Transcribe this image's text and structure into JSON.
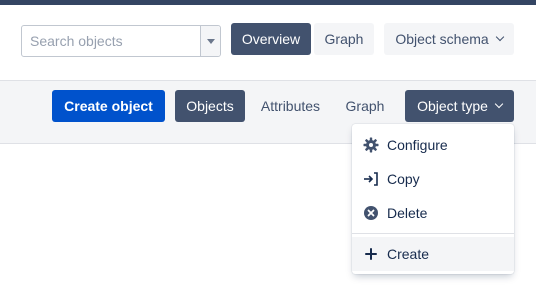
{
  "search": {
    "placeholder": "Search objects"
  },
  "header_nav": {
    "overview": "Overview",
    "graph": "Graph",
    "object_schema": "Object schema"
  },
  "toolbar": {
    "create_object": "Create object",
    "objects": "Objects",
    "attributes": "Attributes",
    "graph": "Graph",
    "object_type": "Object type"
  },
  "dropdown": {
    "items": [
      {
        "label": "Configure",
        "icon": "gear-icon"
      },
      {
        "label": "Copy",
        "icon": "copy-icon"
      },
      {
        "label": "Delete",
        "icon": "delete-icon"
      },
      {
        "label": "Create",
        "icon": "plus-icon"
      }
    ]
  },
  "colors": {
    "dark_button": "#42526e",
    "primary": "#0052cc",
    "top_bar": "#344563",
    "toolbar_bg": "#f4f5f7"
  }
}
